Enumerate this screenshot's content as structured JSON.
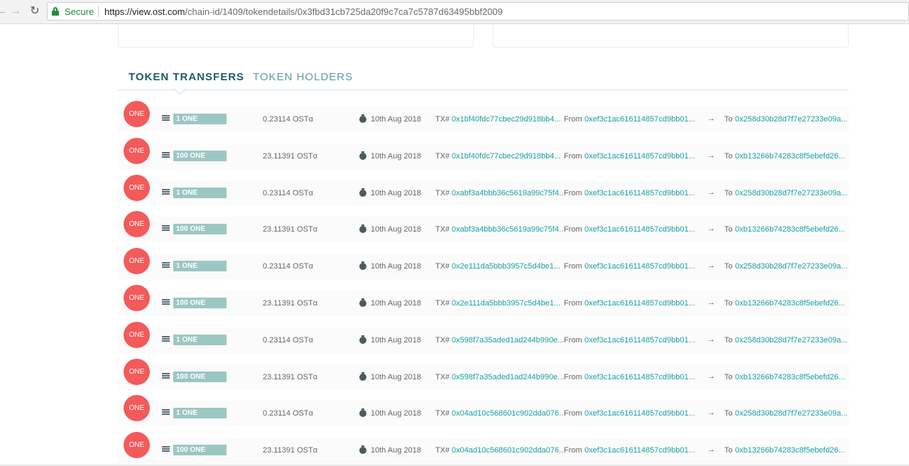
{
  "browser": {
    "back_icon": "arrow-left-icon",
    "forward_icon": "arrow-right-icon",
    "reload_icon": "reload-icon",
    "secure_label": "Secure",
    "url_host": "https://view.ost.com",
    "url_path": "/chain-id/1409/tokendetails/0x3fbd31cb725da20f9c7ca7c5787d63495bbf2009"
  },
  "tabs": {
    "transfers": "TOKEN TRANSFERS",
    "holders": "TOKEN HOLDERS"
  },
  "colors": {
    "avatar": "#f35a5a",
    "badge": "#9bc7c3",
    "link": "#1ba1a1",
    "tab_active": "#1e5d6b"
  },
  "transfers": [
    {
      "avatar": "ONE",
      "badge": "1 ONE",
      "ost": "0.23114 OSTα",
      "date": "10th Aug 2018",
      "tx_label": "TX#",
      "tx": "0x1bf40fdc77cbec29d918bb4...",
      "from_label": "From",
      "from": "0xef3c1ac616114857cd9bb01...",
      "arrow": "→",
      "to_label": "To",
      "to": "0x258d30b28d7f7e27233e09a..."
    },
    {
      "avatar": "ONE",
      "badge": "100 ONE",
      "ost": "23.11391 OSTα",
      "date": "10th Aug 2018",
      "tx_label": "TX#",
      "tx": "0x1bf40fdc77cbec29d918bb4...",
      "from_label": "From",
      "from": "0xef3c1ac616114857cd9bb01...",
      "arrow": "→",
      "to_label": "To",
      "to": "0xb13266b74283c8f5ebefd26..."
    },
    {
      "avatar": "ONE",
      "badge": "1 ONE",
      "ost": "0.23114 OSTα",
      "date": "10th Aug 2018",
      "tx_label": "TX#",
      "tx": "0xabf3a4bbb36c5619a99c75f4...",
      "from_label": "From",
      "from": "0xef3c1ac616114857cd9bb01...",
      "arrow": "→",
      "to_label": "To",
      "to": "0x258d30b28d7f7e27233e09a..."
    },
    {
      "avatar": "ONE",
      "badge": "100 ONE",
      "ost": "23.11391 OSTα",
      "date": "10th Aug 2018",
      "tx_label": "TX#",
      "tx": "0xabf3a4bbb36c5619a99c75f4...",
      "from_label": "From",
      "from": "0xef3c1ac616114857cd9bb01...",
      "arrow": "→",
      "to_label": "To",
      "to": "0xb13266b74283c8f5ebefd26..."
    },
    {
      "avatar": "ONE",
      "badge": "1 ONE",
      "ost": "0.23114 OSTα",
      "date": "10th Aug 2018",
      "tx_label": "TX#",
      "tx": "0x2e111da5bbb3957c5d4be1...",
      "from_label": "From",
      "from": "0xef3c1ac616114857cd9bb01...",
      "arrow": "→",
      "to_label": "To",
      "to": "0x258d30b28d7f7e27233e09a..."
    },
    {
      "avatar": "ONE",
      "badge": "100 ONE",
      "ost": "23.11391 OSTα",
      "date": "10th Aug 2018",
      "tx_label": "TX#",
      "tx": "0x2e111da5bbb3957c5d4be1...",
      "from_label": "From",
      "from": "0xef3c1ac616114857cd9bb01...",
      "arrow": "→",
      "to_label": "To",
      "to": "0xb13266b74283c8f5ebefd26..."
    },
    {
      "avatar": "ONE",
      "badge": "1 ONE",
      "ost": "0.23114 OSTα",
      "date": "10th Aug 2018",
      "tx_label": "TX#",
      "tx": "0x598f7a35aded1ad244b990e...",
      "from_label": "From",
      "from": "0xef3c1ac616114857cd9bb01...",
      "arrow": "→",
      "to_label": "To",
      "to": "0x258d30b28d7f7e27233e09a..."
    },
    {
      "avatar": "ONE",
      "badge": "100 ONE",
      "ost": "23.11391 OSTα",
      "date": "10th Aug 2018",
      "tx_label": "TX#",
      "tx": "0x598f7a35aded1ad244b990e...",
      "from_label": "From",
      "from": "0xef3c1ac616114857cd9bb01...",
      "arrow": "→",
      "to_label": "To",
      "to": "0xb13266b74283c8f5ebefd26..."
    },
    {
      "avatar": "ONE",
      "badge": "1 ONE",
      "ost": "0.23114 OSTα",
      "date": "10th Aug 2018",
      "tx_label": "TX#",
      "tx": "0x04ad10c568601c902dda076...",
      "from_label": "From",
      "from": "0xef3c1ac616114857cd9bb01...",
      "arrow": "→",
      "to_label": "To",
      "to": "0x258d30b28d7f7e27233e09a..."
    },
    {
      "avatar": "ONE",
      "badge": "100 ONE",
      "ost": "23.11391 OSTα",
      "date": "10th Aug 2018",
      "tx_label": "TX#",
      "tx": "0x04ad10c568601c902dda076...",
      "from_label": "From",
      "from": "0xef3c1ac616114857cd9bb01...",
      "arrow": "→",
      "to_label": "To",
      "to": "0xb13266b74283c8f5ebefd26..."
    }
  ]
}
